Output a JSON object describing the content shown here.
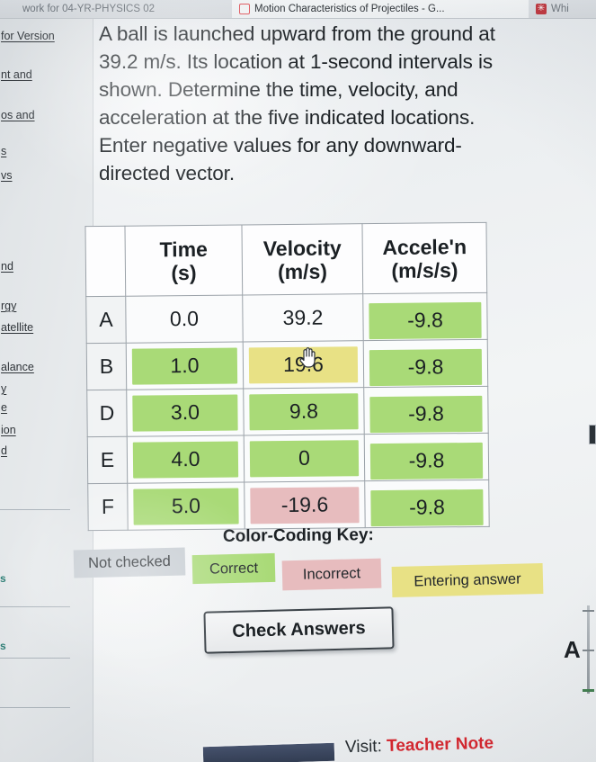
{
  "browser": {
    "tabs": [
      {
        "title": "work for 04-YR-PHYSICS 02",
        "favicon": "blank-icon",
        "active": false
      },
      {
        "title": "Motion Characteristics of Projectiles - G...",
        "favicon": "document-outline-icon",
        "active": true
      },
      {
        "title": "Whi",
        "favicon": "asterisk-red-icon",
        "active": false
      }
    ]
  },
  "sidebar": {
    "links": [
      {
        "label": "for Version"
      },
      {
        "label": "nt and"
      },
      {
        "label": "os and"
      },
      {
        "label": "s"
      },
      {
        "label": "vs"
      },
      {
        "label": "nd"
      },
      {
        "label": "rgy"
      },
      {
        "label": "atellite"
      },
      {
        "label": "alance"
      },
      {
        "label": "y"
      },
      {
        "label": "e"
      },
      {
        "label": "ion"
      },
      {
        "label": "d"
      }
    ],
    "teal_marks": [
      "s",
      "s"
    ]
  },
  "prompt": {
    "line1": "A ball is launched upward from the ground at",
    "line2": "39.2 m/s. Its location at 1-second intervals is",
    "line3": "shown. Determine the time, velocity, and",
    "line4": "acceleration at the five indicated locations.",
    "line5": "Enter negative values for any downward-",
    "line6": "directed vector."
  },
  "table": {
    "corner_label": "",
    "headers": [
      {
        "title": "Time",
        "unit": "(s)"
      },
      {
        "title": "Velocity",
        "unit": "(m/s)"
      },
      {
        "title": "Accele'n",
        "unit": "(m/s/s)"
      }
    ],
    "rows": [
      {
        "label": "A",
        "time": {
          "value": "0.0",
          "state": "none"
        },
        "vel": {
          "value": "39.2",
          "state": "none"
        },
        "acc": {
          "value": "-9.8",
          "state": "correct"
        }
      },
      {
        "label": "B",
        "time": {
          "value": "1.0",
          "state": "correct"
        },
        "vel": {
          "value": "19.6",
          "state": "entering"
        },
        "acc": {
          "value": "-9.8",
          "state": "correct"
        }
      },
      {
        "label": "D",
        "time": {
          "value": "3.0",
          "state": "correct"
        },
        "vel": {
          "value": "9.8",
          "state": "correct"
        },
        "acc": {
          "value": "-9.8",
          "state": "correct"
        }
      },
      {
        "label": "E",
        "time": {
          "value": "4.0",
          "state": "correct"
        },
        "vel": {
          "value": "0",
          "state": "correct"
        },
        "acc": {
          "value": "-9.8",
          "state": "correct"
        }
      },
      {
        "label": "F",
        "time": {
          "value": "5.0",
          "state": "correct"
        },
        "vel": {
          "value": "-19.6",
          "state": "wrong"
        },
        "acc": {
          "value": "-9.8",
          "state": "correct"
        }
      }
    ]
  },
  "legend": {
    "title": "Color-Coding Key:",
    "chips": [
      {
        "label": "Not checked",
        "color": "#c6ccd2"
      },
      {
        "label": "Correct",
        "color": "#a9da77"
      },
      {
        "label": "Incorrect",
        "color": "#e7bcbe"
      },
      {
        "label": "Entering answer",
        "color": "#e8e185"
      }
    ]
  },
  "actions": {
    "check_answers": "Check Answers"
  },
  "diagram": {
    "marker_label": "A"
  },
  "footer": {
    "prefix": "Visit:",
    "brand": "Teacher Note"
  },
  "colors": {
    "correct": "#a9da77",
    "incorrect": "#e7bcbe",
    "entering": "#e8e185",
    "not_checked": "#c6ccd2",
    "brand_red": "#d5242c"
  }
}
